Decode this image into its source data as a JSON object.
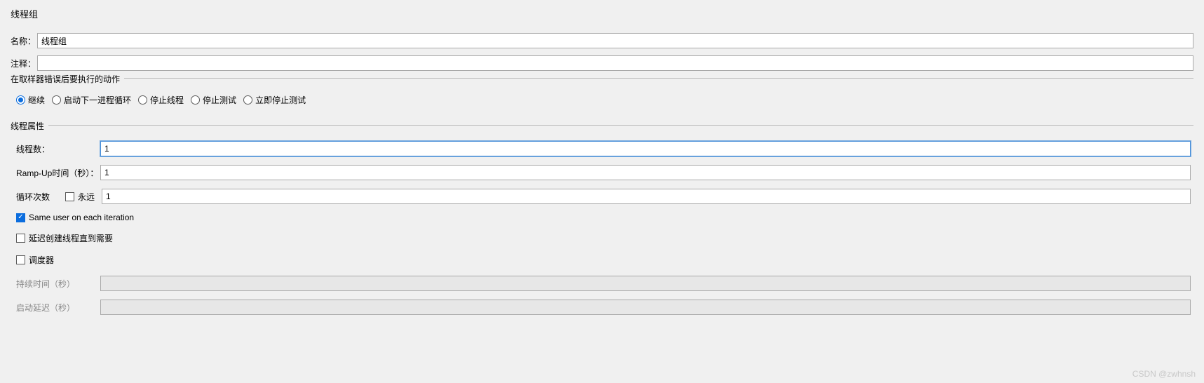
{
  "header": {
    "title": "线程组"
  },
  "fields": {
    "name_label": "名称：",
    "name_value": "线程组",
    "comment_label": "注释：",
    "comment_value": ""
  },
  "error_action": {
    "legend": "在取样器错误后要执行的动作",
    "options": {
      "continue": "继续",
      "start_next": "启动下一进程循环",
      "stop_thread": "停止线程",
      "stop_test": "停止测试",
      "stop_test_now": "立即停止测试"
    },
    "selected": "continue"
  },
  "thread_props": {
    "legend": "线程属性",
    "threads_label": "线程数：",
    "threads_value": "1",
    "rampup_label": "Ramp-Up时间（秒）：",
    "rampup_value": "1",
    "loop_label": "循环次数",
    "forever_label": "永远",
    "loop_value": "1",
    "same_user_label": "Same user on each iteration",
    "delay_create_label": "延迟创建线程直到需要",
    "scheduler_label": "调度器",
    "duration_label": "持续时间（秒）",
    "duration_value": "",
    "startup_delay_label": "启动延迟（秒）",
    "startup_delay_value": ""
  },
  "watermark": "CSDN @zwhnsh"
}
